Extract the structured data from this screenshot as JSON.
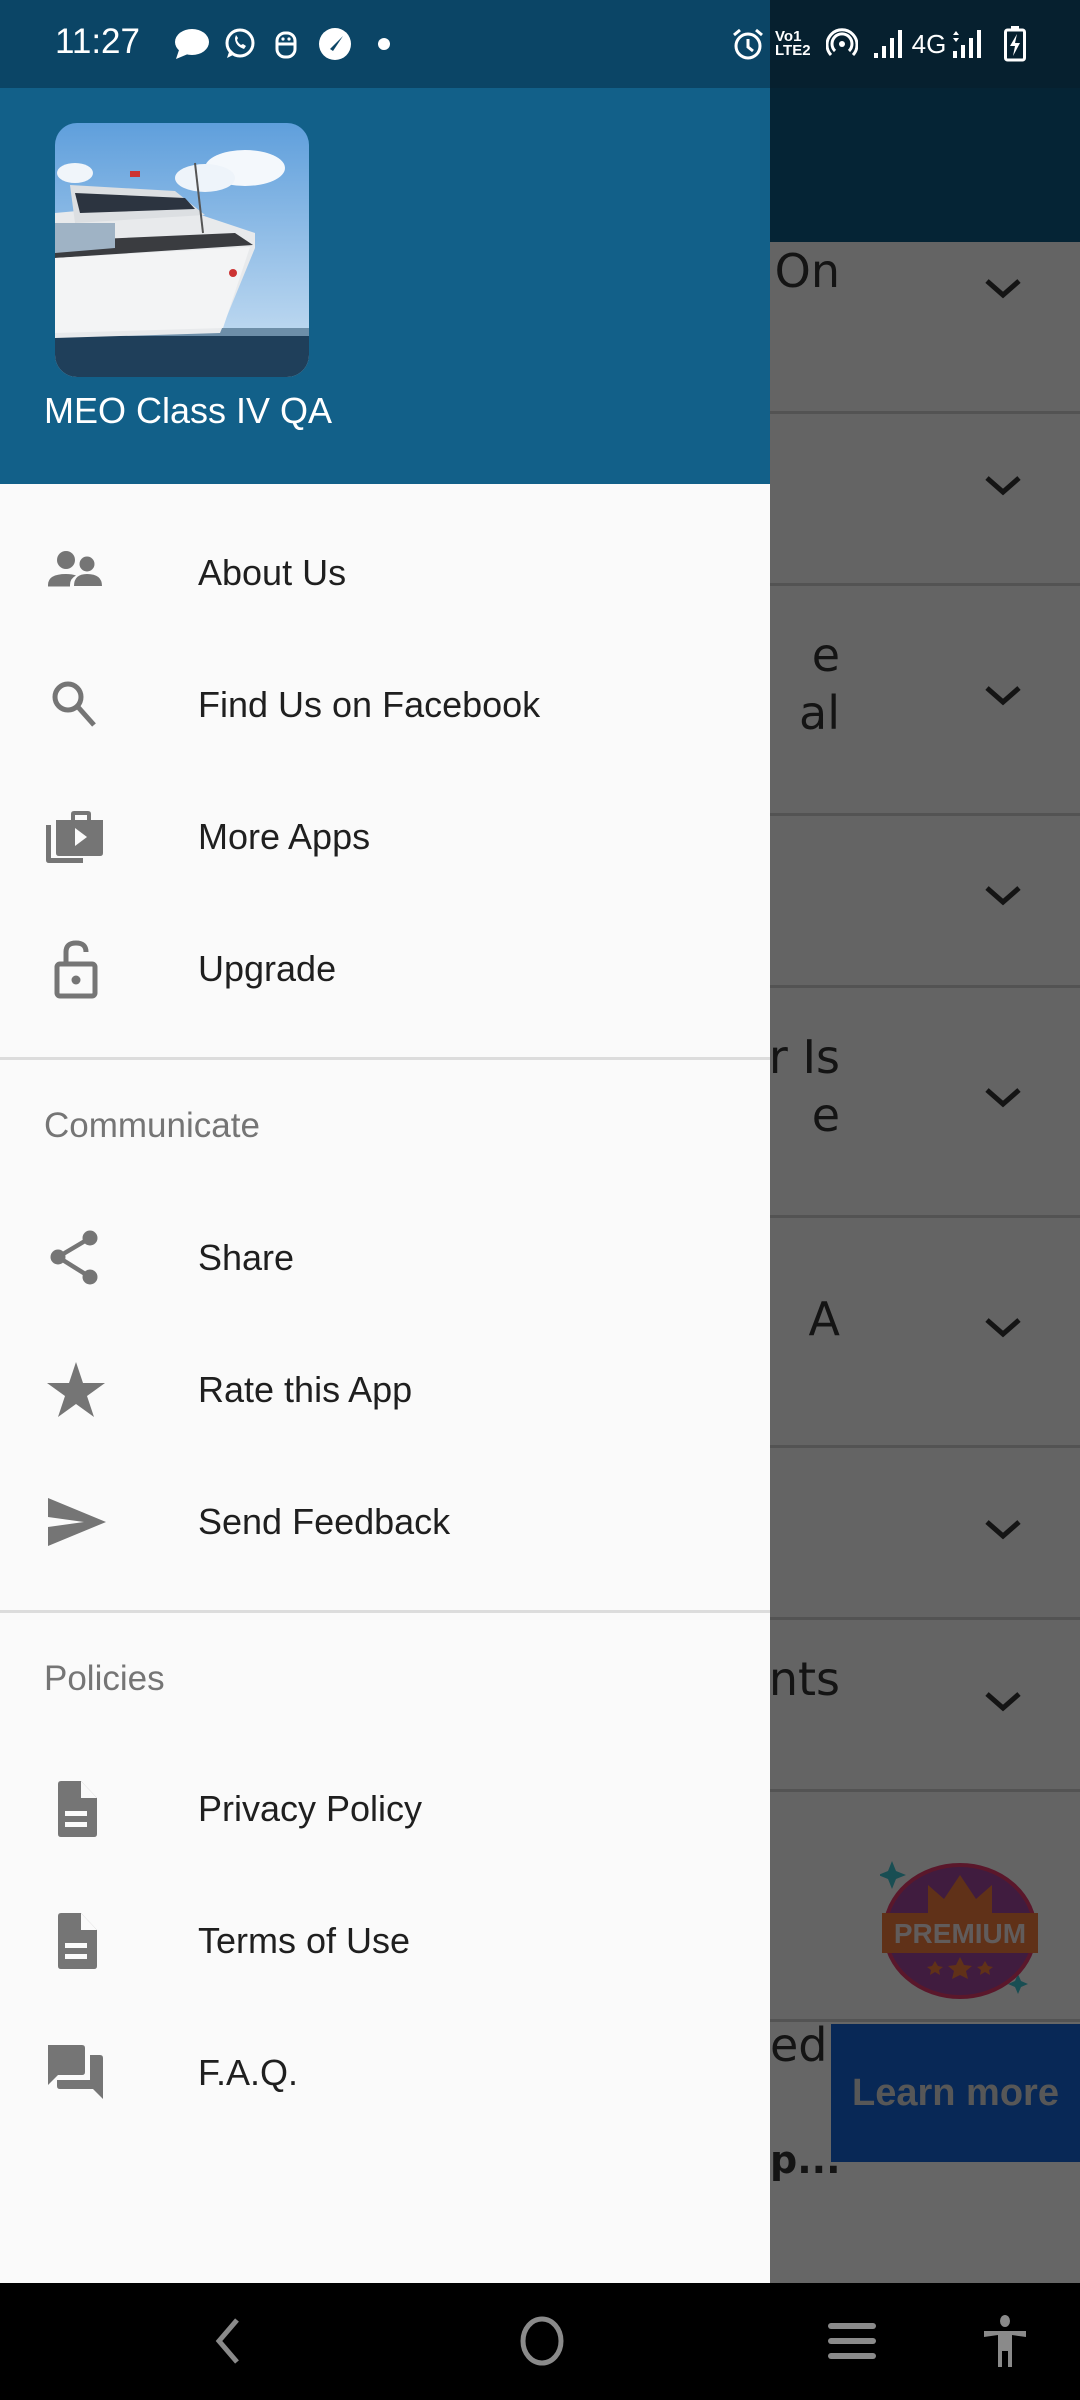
{
  "status_bar": {
    "time": "11:27",
    "left_icons": [
      "message-icon",
      "whatsapp-icon",
      "app-notification-icon",
      "speedometer-icon",
      "more-notifications-dot"
    ],
    "right_icons": [
      "alarm-icon",
      "volte-icon",
      "hotspot-icon",
      "signal-sim1-icon",
      "signal-sim2-icon",
      "battery-charging-icon"
    ],
    "volte_label_top": "Vo",
    "volte_label_sim": "1",
    "volte_label_bottom": "LTE2",
    "network_type": "4G"
  },
  "drawer": {
    "header": {
      "app_name": "MEO Class IV QA",
      "logo": "cruise-ship-image"
    },
    "main_items": [
      {
        "label": "About Us",
        "icon": "people-icon"
      },
      {
        "label": "Find Us on Facebook",
        "icon": "search-icon"
      },
      {
        "label": "More Apps",
        "icon": "shop-apps-icon"
      },
      {
        "label": "Upgrade",
        "icon": "lock-open-icon"
      }
    ],
    "sections": [
      {
        "title": "Communicate",
        "items": [
          {
            "label": "Share",
            "icon": "share-icon"
          },
          {
            "label": "Rate this App",
            "icon": "star-icon"
          },
          {
            "label": "Send Feedback",
            "icon": "send-icon"
          }
        ]
      },
      {
        "title": "Policies",
        "items": [
          {
            "label": "Privacy Policy",
            "icon": "document-icon"
          },
          {
            "label": "Terms of Use",
            "icon": "document-icon"
          },
          {
            "label": "F.A.Q.",
            "icon": "forum-icon"
          }
        ]
      }
    ]
  },
  "background_app": {
    "cards": [
      {
        "partial_title_lines": [
          "On"
        ]
      },
      {
        "partial_title_lines": []
      },
      {
        "partial_title_lines": [
          "e",
          "al"
        ]
      },
      {
        "partial_title_lines": []
      },
      {
        "partial_title_lines": [
          "r Is",
          "e"
        ]
      },
      {
        "partial_title_lines": [
          "A"
        ]
      },
      {
        "partial_title_lines": []
      },
      {
        "partial_title_lines": [
          "nts"
        ]
      },
      {
        "partial_title_lines": []
      }
    ],
    "premium_badge_label": "PREMIUM",
    "ad": {
      "partial_title": "ed",
      "partial_subtitle": "p...",
      "cta_label": "Learn more"
    }
  },
  "nav_bar": {
    "buttons": [
      "back-icon",
      "home-icon",
      "recents-icon",
      "accessibility-icon"
    ]
  },
  "colors": {
    "drawer_header": "#126089",
    "status_bar": "#0b4566",
    "drawer_background": "#fafafa",
    "icon_gray": "#757575",
    "label_text": "#1f1f1f",
    "section_title": "#757575",
    "ad_cta": "#1565d8"
  }
}
